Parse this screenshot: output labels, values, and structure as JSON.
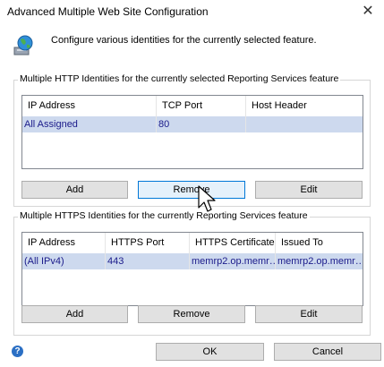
{
  "window": {
    "title": "Advanced Multiple Web Site Configuration",
    "close_glyph": "✕"
  },
  "header": {
    "icon": "globe-computer-icon",
    "description": "Configure various identities for the currently selected feature."
  },
  "http_group": {
    "label": "Multiple HTTP Identities for the currently selected Reporting Services feature",
    "columns": [
      "IP Address",
      "TCP Port",
      "Host Header"
    ],
    "rows": [
      [
        "All Assigned",
        "80",
        ""
      ]
    ],
    "buttons": {
      "add": "Add",
      "remove": "Remove",
      "edit": "Edit"
    }
  },
  "https_group": {
    "label": "Multiple HTTPS Identities for the currently Reporting Services feature",
    "columns": [
      "IP Address",
      "HTTPS Port",
      "HTTPS Certificate",
      "Issued To"
    ],
    "rows": [
      [
        "(All IPv4)",
        "443",
        "memrp2.op.memr…",
        "memrp2.op.memr…"
      ]
    ],
    "buttons": {
      "add": "Add",
      "remove": "Remove",
      "edit": "Edit"
    }
  },
  "footer": {
    "help_icon": "help-icon",
    "ok": "OK",
    "cancel": "Cancel"
  },
  "colors": {
    "selection_row": "#cdd9ee",
    "focus_border": "#0078d7"
  }
}
